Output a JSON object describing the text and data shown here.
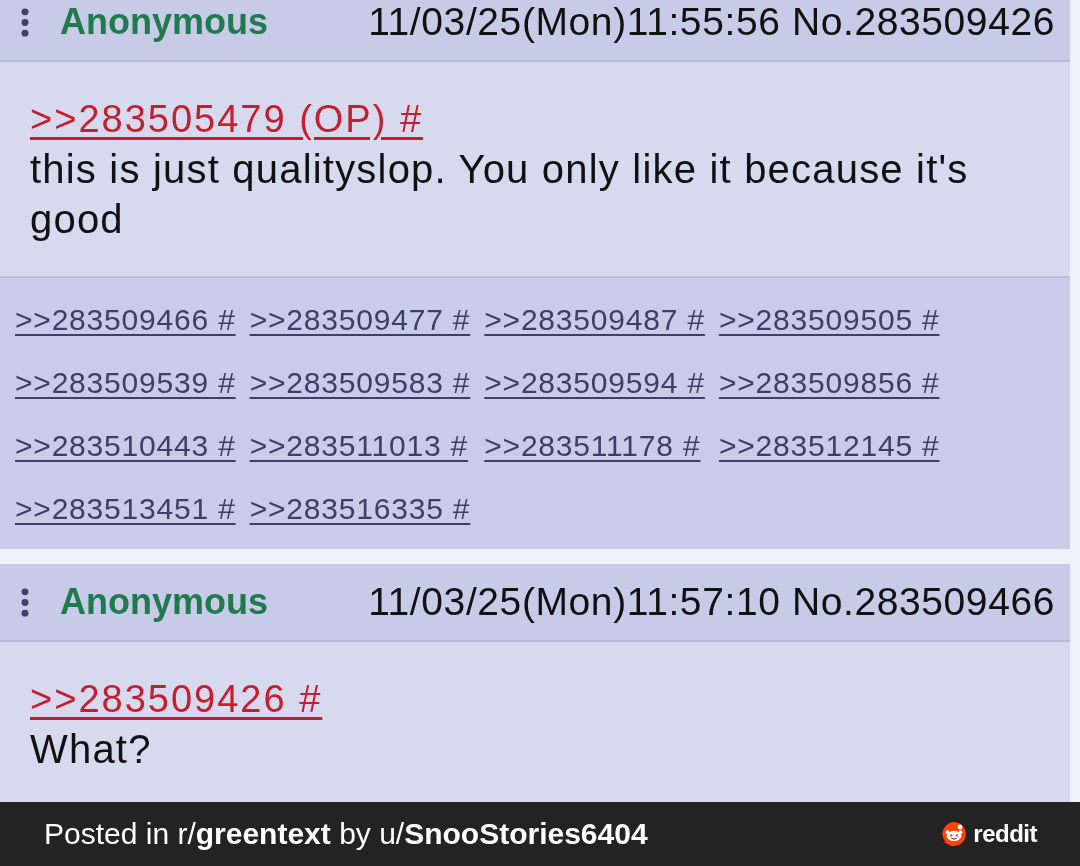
{
  "posts": [
    {
      "author": "Anonymous",
      "meta": "11/03/25(Mon)11:55:56 No.283509426",
      "quote_link": ">>283505479 (OP) #",
      "body": "this is just qualityslop. You only like it because it's good",
      "replies": [
        ">>283509466 #",
        ">>283509477 #",
        ">>283509487 #",
        ">>283509505 #",
        ">>283509539 #",
        ">>283509583 #",
        ">>283509594 #",
        ">>283509856 #",
        ">>283510443 #",
        ">>283511013 #",
        ">>283511178 #",
        ">>283512145 #",
        ">>283513451 #",
        ">>283516335 #"
      ]
    },
    {
      "author": "Anonymous",
      "meta": "11/03/25(Mon)11:57:10 No.283509466",
      "quote_link": ">>283509426 #",
      "body": "What?"
    }
  ],
  "footer": {
    "caption": "Posted in r/**greentext** by u/**SnooStories6404**",
    "brand": "reddit"
  }
}
